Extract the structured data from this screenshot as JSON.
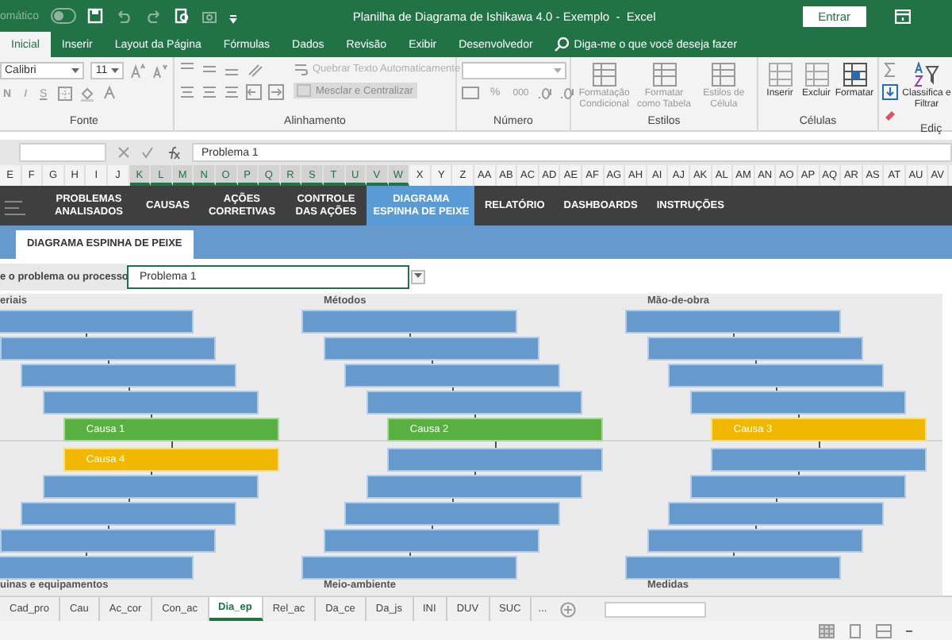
{
  "title_bar": {
    "autosave_label": "omático",
    "autosave_on": false,
    "title": "Planilha de Diagrama de Ishikawa 4.0 - Exemplo  -  Excel",
    "sign_in": "Entrar"
  },
  "ribbon_tabs": [
    {
      "label": "Inicial",
      "selected": true
    },
    {
      "label": "Inserir",
      "selected": false
    },
    {
      "label": "Layout da Página",
      "selected": false
    },
    {
      "label": "Fórmulas",
      "selected": false
    },
    {
      "label": "Dados",
      "selected": false
    },
    {
      "label": "Revisão",
      "selected": false
    },
    {
      "label": "Exibir",
      "selected": false
    },
    {
      "label": "Desenvolvedor",
      "selected": false
    }
  ],
  "tell_me": {
    "placeholder": "Diga-me o que você deseja fazer"
  },
  "ribbon": {
    "font_name": "Calibri",
    "font_size": "11",
    "bold": "N",
    "italic": "I",
    "underline": "S",
    "wrap_text": "Quebrar Texto Automaticamente",
    "merge_center": "Mesclar e Centralizar",
    "percent": "%",
    "thousands": "000",
    "conditional_format": "Formatação Condicional",
    "format_table": "Formatar como Tabela",
    "cell_styles": "Estilos de Célula",
    "insert": "Inserir",
    "delete": "Excluir",
    "format": "Formatar",
    "sort_filter": "Classifica e Filtrar",
    "groups": [
      "Fonte",
      "Alinhamento",
      "Número",
      "Estilos",
      "Células",
      "Ediç"
    ]
  },
  "formula_bar": {
    "value": "Problema 1"
  },
  "column_headers": [
    {
      "label": "E",
      "selected": false
    },
    {
      "label": "F",
      "selected": false
    },
    {
      "label": "G",
      "selected": false
    },
    {
      "label": "H",
      "selected": false
    },
    {
      "label": "I",
      "selected": false
    },
    {
      "label": "J",
      "selected": false
    },
    {
      "label": "K",
      "selected": true
    },
    {
      "label": "L",
      "selected": true
    },
    {
      "label": "M",
      "selected": true
    },
    {
      "label": "N",
      "selected": true
    },
    {
      "label": "O",
      "selected": true
    },
    {
      "label": "P",
      "selected": true
    },
    {
      "label": "Q",
      "selected": true
    },
    {
      "label": "R",
      "selected": true
    },
    {
      "label": "S",
      "selected": true
    },
    {
      "label": "T",
      "selected": true
    },
    {
      "label": "U",
      "selected": true
    },
    {
      "label": "V",
      "selected": true
    },
    {
      "label": "W",
      "selected": true
    },
    {
      "label": "X",
      "selected": false
    },
    {
      "label": "Y",
      "selected": false
    },
    {
      "label": "Z",
      "selected": false
    },
    {
      "label": "AA",
      "selected": false
    },
    {
      "label": "AB",
      "selected": false
    },
    {
      "label": "AC",
      "selected": false
    },
    {
      "label": "AD",
      "selected": false
    },
    {
      "label": "AE",
      "selected": false
    },
    {
      "label": "AF",
      "selected": false
    },
    {
      "label": "AG",
      "selected": false
    },
    {
      "label": "AH",
      "selected": false
    },
    {
      "label": "AI",
      "selected": false
    },
    {
      "label": "AJ",
      "selected": false
    },
    {
      "label": "AK",
      "selected": false
    },
    {
      "label": "AL",
      "selected": false
    },
    {
      "label": "AM",
      "selected": false
    },
    {
      "label": "AN",
      "selected": false
    },
    {
      "label": "AO",
      "selected": false
    },
    {
      "label": "AP",
      "selected": false
    },
    {
      "label": "AQ",
      "selected": false
    },
    {
      "label": "AR",
      "selected": false
    },
    {
      "label": "AS",
      "selected": false
    },
    {
      "label": "AT",
      "selected": false
    },
    {
      "label": "AU",
      "selected": false
    },
    {
      "label": "AV",
      "selected": false
    }
  ],
  "nav": [
    {
      "label": "PROBLEMAS ANALISADOS",
      "selected": false
    },
    {
      "label": "CAUSAS",
      "selected": false
    },
    {
      "label": "AÇÕES CORRETIVAS",
      "selected": false
    },
    {
      "label": "CONTROLE DAS AÇÕES",
      "selected": false
    },
    {
      "label": "DIAGRAMA ESPINHA DE PEIXE",
      "selected": true
    },
    {
      "label": "RELATÓRIO",
      "selected": false
    },
    {
      "label": "DASHBOARDS",
      "selected": false
    },
    {
      "label": "INSTRUÇÕES",
      "selected": false
    }
  ],
  "section_tab": "DIAGRAMA ESPINHA DE PEIXE",
  "problem_selector": {
    "label": "e o problema ou processo",
    "value": "Problema 1"
  },
  "diagram": {
    "columns": [
      {
        "top_label": "eriais",
        "bottom_label": "uinas e equipamentos",
        "bars": [
          {
            "color": "#6699cc"
          },
          {
            "color": "#6699cc"
          },
          {
            "color": "#6699cc"
          },
          {
            "color": "#6699cc"
          },
          {
            "color": "#57b040",
            "text": "Causa 1"
          },
          {
            "color": "#f0b800",
            "text": "Causa 4"
          },
          {
            "color": "#6699cc"
          },
          {
            "color": "#6699cc"
          },
          {
            "color": "#6699cc"
          },
          {
            "color": "#6699cc"
          }
        ]
      },
      {
        "top_label": "Métodos",
        "bottom_label": "Meio-ambiente",
        "bars": [
          {
            "color": "#6699cc"
          },
          {
            "color": "#6699cc"
          },
          {
            "color": "#6699cc"
          },
          {
            "color": "#6699cc"
          },
          {
            "color": "#57b040",
            "text": "Causa 2"
          },
          {
            "color": "#6699cc"
          },
          {
            "color": "#6699cc"
          },
          {
            "color": "#6699cc"
          },
          {
            "color": "#6699cc"
          },
          {
            "color": "#6699cc"
          }
        ]
      },
      {
        "top_label": "Mão-de-obra",
        "bottom_label": "Medidas",
        "bars": [
          {
            "color": "#6699cc"
          },
          {
            "color": "#6699cc"
          },
          {
            "color": "#6699cc"
          },
          {
            "color": "#6699cc"
          },
          {
            "color": "#f0b800",
            "text": "Causa 3"
          },
          {
            "color": "#6699cc"
          },
          {
            "color": "#6699cc"
          },
          {
            "color": "#6699cc"
          },
          {
            "color": "#6699cc"
          },
          {
            "color": "#6699cc"
          }
        ]
      }
    ]
  },
  "sheet_tabs": [
    {
      "label": "Cad_pro",
      "selected": false
    },
    {
      "label": "Cau",
      "selected": false
    },
    {
      "label": "Ac_cor",
      "selected": false
    },
    {
      "label": "Con_ac",
      "selected": false
    },
    {
      "label": "Dia_ep",
      "selected": true
    },
    {
      "label": "Rel_ac",
      "selected": false
    },
    {
      "label": "Da_ce",
      "selected": false
    },
    {
      "label": "Da_js",
      "selected": false
    },
    {
      "label": "INI",
      "selected": false
    },
    {
      "label": "DUV",
      "selected": false
    },
    {
      "label": "SUC",
      "selected": false
    }
  ],
  "more_tabs": "..."
}
